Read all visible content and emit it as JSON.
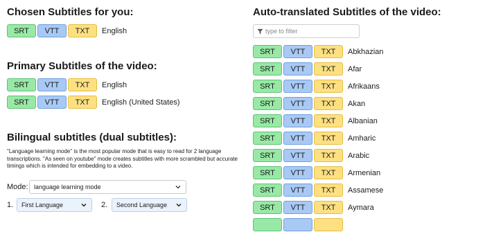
{
  "chosen": {
    "title": "Chosen Subtitles for you:",
    "items": [
      {
        "lang": "English"
      }
    ]
  },
  "primary": {
    "title": "Primary Subtitles of the video:",
    "items": [
      {
        "lang": "English"
      },
      {
        "lang": "English (United States)"
      }
    ]
  },
  "bilingual": {
    "title": "Bilingual subtitles (dual subtitles):",
    "description": "\"Language learning mode\" is the most popular mode that is easy to read for 2 language transcriptions. \"As seen on youtube\" mode creates subtitles with more scrambled but accurate timings which is intended for embedding to a video.",
    "mode_label": "Mode:",
    "mode_value": "language learning mode",
    "first_num": "1.",
    "first_value": "First Language",
    "second_num": "2.",
    "second_value": "Second Language"
  },
  "auto": {
    "title": "Auto-translated Subtitles of the video:",
    "filter_placeholder": "type to filter",
    "languages": [
      "Abkhazian",
      "Afar",
      "Afrikaans",
      "Akan",
      "Albanian",
      "Amharic",
      "Arabic",
      "Armenian",
      "Assamese",
      "Aymara"
    ]
  },
  "formats": {
    "srt": "SRT",
    "vtt": "VTT",
    "txt": "TXT"
  },
  "colors": {
    "srt": "#98e9a6",
    "vtt": "#a9c9f5",
    "txt": "#fde082"
  },
  "icons": {
    "filter": "filter-icon",
    "dropdown": "chevron-down-icon"
  }
}
